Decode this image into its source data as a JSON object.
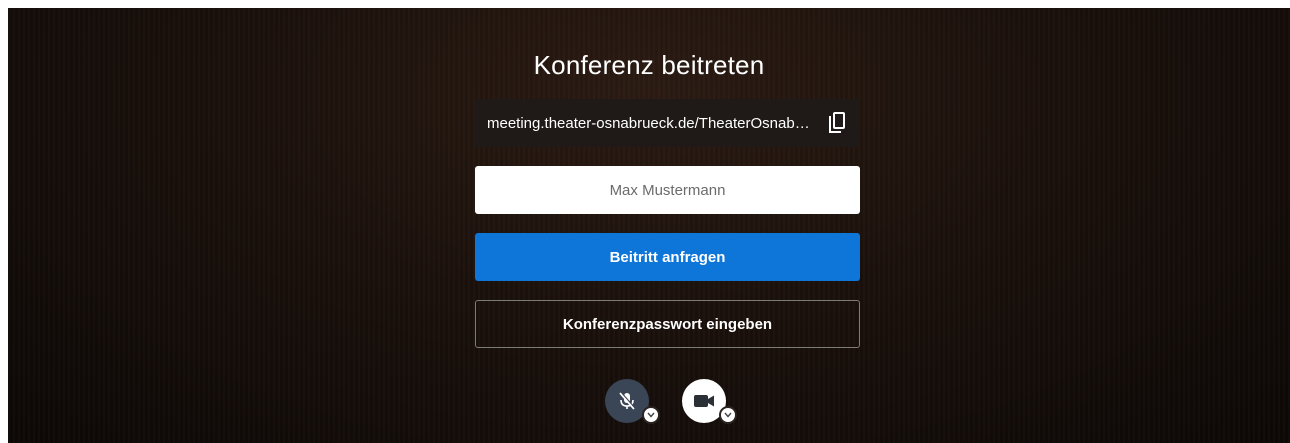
{
  "prejoin": {
    "title": "Konferenz beitreten",
    "meeting_url": "meeting.theater-osnabrueck.de/TheaterOsnabrueck",
    "name_input": {
      "value": "",
      "placeholder": "Max Mustermann"
    },
    "join_button_label": "Beitritt anfragen",
    "password_button_label": "Konferenzpasswort eingeben",
    "controls": {
      "microphone": {
        "state": "muted",
        "icon": "microphone-off-icon"
      },
      "camera": {
        "state": "on",
        "icon": "video-camera-icon"
      }
    }
  },
  "colors": {
    "background": "#1a100b",
    "accent": "#0e76d8",
    "url_box": "#1f1a17",
    "mic_button": "#3a4556"
  }
}
